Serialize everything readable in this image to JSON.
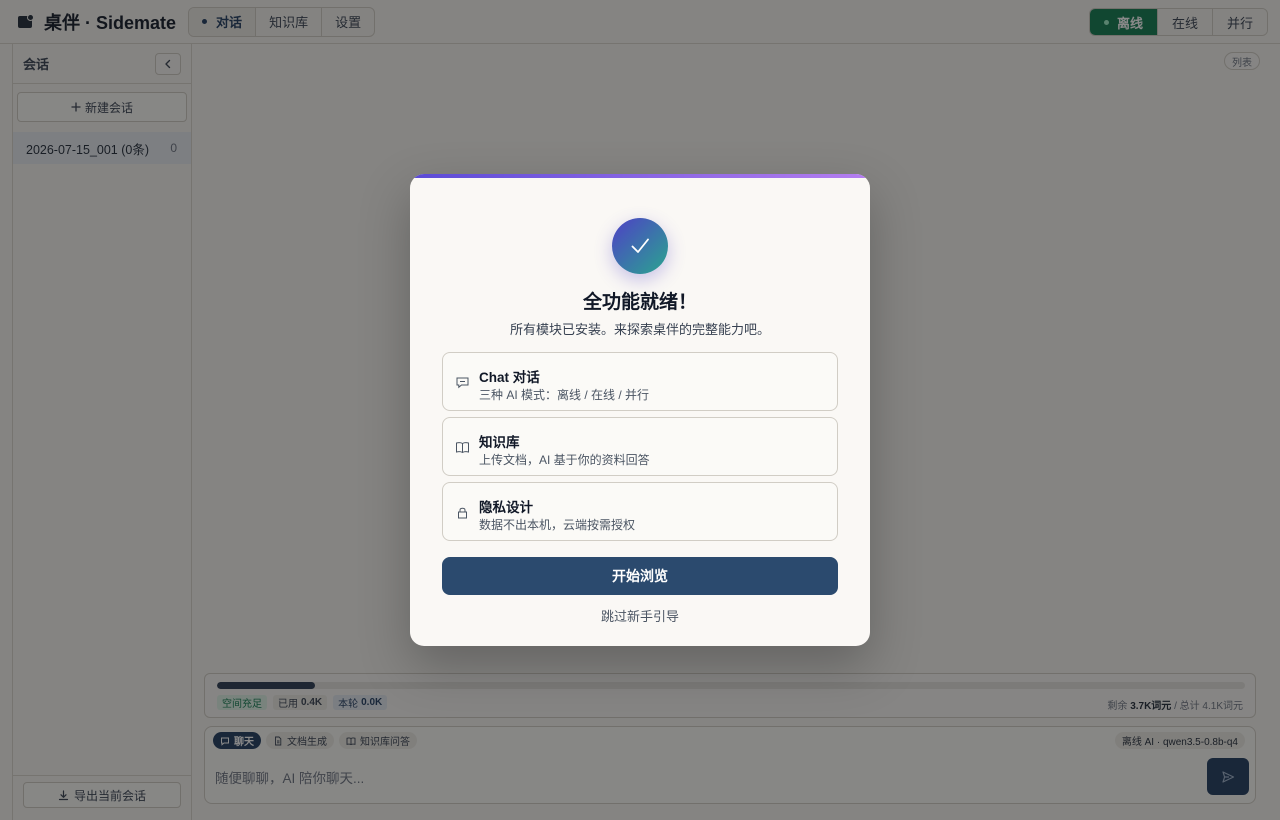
{
  "app": {
    "title_cn": "桌伴",
    "title_sep": " · ",
    "title_en": "Sidemate"
  },
  "nav": {
    "tabs": [
      {
        "label": "对话",
        "active": true
      },
      {
        "label": "知识库",
        "active": false
      },
      {
        "label": "设置",
        "active": false
      }
    ]
  },
  "mode_switch": {
    "options": [
      {
        "label": "离线",
        "active": true
      },
      {
        "label": "在线",
        "active": false
      },
      {
        "label": "并行",
        "active": false
      }
    ]
  },
  "sidebar": {
    "title": "会话",
    "new_chat_label": "新建会话",
    "sessions": [
      {
        "name": "2026-07-15_001 (0条)",
        "count": "0"
      }
    ],
    "export_label": "导出当前会话"
  },
  "main": {
    "list_chip": "列表",
    "usage": {
      "fill_fraction": 0.095,
      "tag_space": "空间充足",
      "used_label": "已用",
      "used_value": "0.4K",
      "round_label": "本轮",
      "round_value": "0.0K",
      "remain_label": "剩余",
      "remain_value": "3.7K词元",
      "total_text": "/ 总计 4.1K词元"
    },
    "input": {
      "chips": [
        {
          "label": "聊天",
          "icon": "chat-bubble-icon",
          "active": true
        },
        {
          "label": "文档生成",
          "icon": "document-icon",
          "active": false
        },
        {
          "label": "知识库问答",
          "icon": "book-icon",
          "active": false
        }
      ],
      "model_label": "离线 AI · qwen3.5-0.8b-q4",
      "placeholder": "随便聊聊，AI 陪你聊天..."
    }
  },
  "modal": {
    "title": "全功能就绪！",
    "subtitle": "所有模块已安装。来探索桌伴的完整能力吧。",
    "features": [
      {
        "icon": "chat-bubble-icon",
        "title": "Chat 对话",
        "desc": "三种 AI 模式：离线 / 在线 / 并行"
      },
      {
        "icon": "book-icon",
        "title": "知识库",
        "desc": "上传文档，AI 基于你的资料回答"
      },
      {
        "icon": "lock-icon",
        "title": "隐私设计",
        "desc": "数据不出本机，云端按需授权"
      }
    ],
    "start_label": "开始浏览",
    "skip_label": "跳过新手引导"
  },
  "colors": {
    "accent_dark": "#1e3a5f",
    "offline_green": "#0e7a4f",
    "gradient_start": "#5b4bd6",
    "gradient_end": "#b57ef0"
  }
}
